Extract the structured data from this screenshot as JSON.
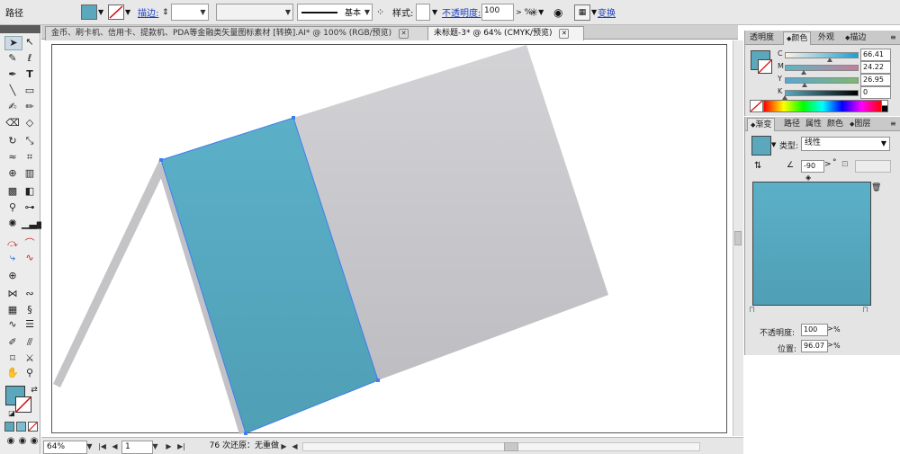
{
  "control_bar": {
    "object_type": "路径",
    "stroke_label": "描边:",
    "stroke_profile": "基本",
    "style_label": "样式:",
    "opacity_label": "不透明度:",
    "opacity_value": "100",
    "opacity_unit": "%",
    "transform_label": "变换"
  },
  "tabs": [
    {
      "label": "金币、刷卡机、信用卡、提款机、PDA等金融类矢量图标素材 [转换].AI* @ 100% (RGB/预览)",
      "active": false
    },
    {
      "label": "未标题-3* @ 64% (CMYK/预览)",
      "active": true
    }
  ],
  "status_bar": {
    "zoom": "64%",
    "page": "1",
    "status_text": "76 次还原：无重做"
  },
  "color_panel": {
    "tabs": [
      "透明度",
      "颜色",
      "外观",
      "描边"
    ],
    "active_tab": "颜色",
    "channels": [
      {
        "label": "C",
        "value": "66.41"
      },
      {
        "label": "M",
        "value": "24.22"
      },
      {
        "label": "Y",
        "value": "26.95"
      },
      {
        "label": "K",
        "value": "0"
      }
    ],
    "fill_color": "#5ba8bd"
  },
  "gradient_panel": {
    "tabs": [
      "渐变",
      "路径",
      "属性",
      "颜色",
      "图层"
    ],
    "active_tab": "渐变",
    "type_label": "类型:",
    "type_value": "线性",
    "angle_value": "-90",
    "angle_unit": "°",
    "opacity_label": "不透明度:",
    "opacity_value": "100",
    "opacity_unit": "%",
    "location_label": "位置:",
    "location_value": "96.07",
    "location_unit": "%",
    "gradient_colors": [
      "#5bb0c8",
      "#4f9fb5"
    ]
  },
  "colors": {
    "accent_teal": "#5ba8bd",
    "ui_gray": "#e4e4e4",
    "link_blue": "#1a3fbf"
  }
}
